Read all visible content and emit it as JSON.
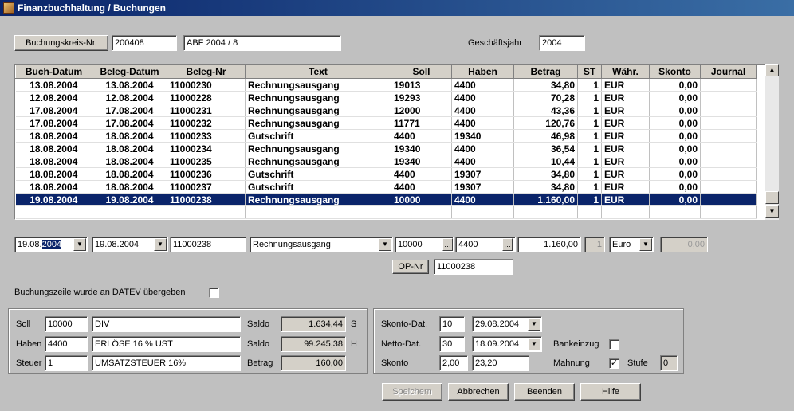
{
  "window": {
    "title": "Finanzbuchhaltung / Buchungen"
  },
  "header": {
    "buchungskreis_label": "Buchungskreis-Nr.",
    "buchungskreis_value": "200408",
    "description_value": "ABF 2004 / 8",
    "geschaeftsjahr_label": "Geschäftsjahr",
    "geschaeftsjahr_value": "2004"
  },
  "table": {
    "columns": [
      "Buch-Datum",
      "Beleg-Datum",
      "Beleg-Nr",
      "Text",
      "Soll",
      "Haben",
      "Betrag",
      "ST",
      "Währ.",
      "Skonto",
      "Journal"
    ],
    "rows": [
      [
        "13.08.2004",
        "13.08.2004",
        "11000230",
        "Rechnungsausgang",
        "19013",
        "4400",
        "34,80",
        "1",
        "EUR",
        "0,00",
        ""
      ],
      [
        "12.08.2004",
        "12.08.2004",
        "11000228",
        "Rechnungsausgang",
        "19293",
        "4400",
        "70,28",
        "1",
        "EUR",
        "0,00",
        ""
      ],
      [
        "17.08.2004",
        "17.08.2004",
        "11000231",
        "Rechnungsausgang",
        "12000",
        "4400",
        "43,36",
        "1",
        "EUR",
        "0,00",
        ""
      ],
      [
        "17.08.2004",
        "17.08.2004",
        "11000232",
        "Rechnungsausgang",
        "11771",
        "4400",
        "120,76",
        "1",
        "EUR",
        "0,00",
        ""
      ],
      [
        "18.08.2004",
        "18.08.2004",
        "11000233",
        "Gutschrift",
        "4400",
        "19340",
        "46,98",
        "1",
        "EUR",
        "0,00",
        ""
      ],
      [
        "18.08.2004",
        "18.08.2004",
        "11000234",
        "Rechnungsausgang",
        "19340",
        "4400",
        "36,54",
        "1",
        "EUR",
        "0,00",
        ""
      ],
      [
        "18.08.2004",
        "18.08.2004",
        "11000235",
        "Rechnungsausgang",
        "19340",
        "4400",
        "10,44",
        "1",
        "EUR",
        "0,00",
        ""
      ],
      [
        "18.08.2004",
        "18.08.2004",
        "11000236",
        "Gutschrift",
        "4400",
        "19307",
        "34,80",
        "1",
        "EUR",
        "0,00",
        ""
      ],
      [
        "18.08.2004",
        "18.08.2004",
        "11000237",
        "Gutschrift",
        "4400",
        "19307",
        "34,80",
        "1",
        "EUR",
        "0,00",
        ""
      ],
      [
        "19.08.2004",
        "19.08.2004",
        "11000238",
        "Rechnungsausgang",
        "10000",
        "4400",
        "1.160,00",
        "1",
        "EUR",
        "0,00",
        ""
      ]
    ],
    "selected_row": 9
  },
  "entry": {
    "buch_datum_prefix": "19.08.",
    "buch_datum_sel": "2004",
    "beleg_datum": "19.08.2004",
    "beleg_nr": "11000238",
    "text": "Rechnungsausgang",
    "soll": "10000",
    "haben": "4400",
    "betrag": "1.160,00",
    "st": "1",
    "waehrung": "Euro",
    "skonto": "0,00",
    "op_nr_label": "OP-Nr",
    "op_nr_value": "11000238",
    "datev_label": "Buchungszeile wurde an DATEV übergeben"
  },
  "accounts": {
    "soll_label": "Soll",
    "soll_nr": "10000",
    "soll_name": "DIV",
    "soll_saldo_label": "Saldo",
    "soll_saldo": "1.634,44",
    "soll_saldo_side": "S",
    "haben_label": "Haben",
    "haben_nr": "4400",
    "haben_name": "ERLÖSE 16 % UST",
    "haben_saldo_label": "Saldo",
    "haben_saldo": "99.245,38",
    "haben_saldo_side": "H",
    "steuer_label": "Steuer",
    "steuer_nr": "1",
    "steuer_name": "UMSATZSTEUER 16%",
    "steuer_betrag_label": "Betrag",
    "steuer_betrag": "160,00"
  },
  "payment": {
    "skonto_dat_label": "Skonto-Dat.",
    "skonto_dat_days": "10",
    "skonto_dat_date": "29.08.2004",
    "netto_dat_label": "Netto-Dat.",
    "netto_dat_days": "30",
    "netto_dat_date": "18.09.2004",
    "skonto_label": "Skonto",
    "skonto_pct": "2,00",
    "skonto_amount": "23,20",
    "bankeinzug_label": "Bankeinzug",
    "mahnung_label": "Mahnung",
    "stufe_label": "Stufe",
    "stufe_value": "0"
  },
  "buttons": {
    "speichern": "Speichern",
    "abbrechen": "Abbrechen",
    "beenden": "Beenden",
    "hilfe": "Hilfe"
  },
  "colors": {
    "selection": "#0a246a",
    "titlebar": "#0a246a"
  }
}
